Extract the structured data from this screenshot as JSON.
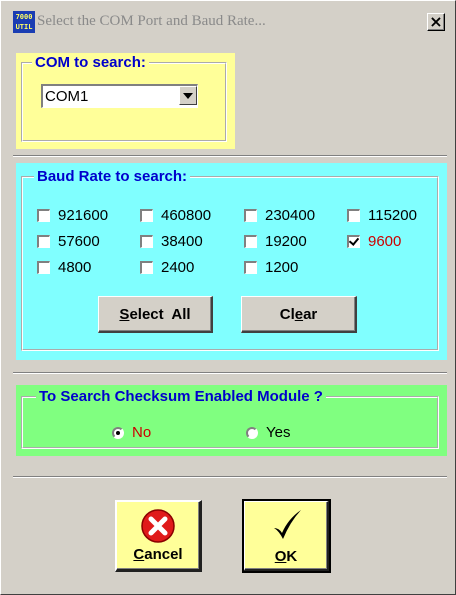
{
  "window": {
    "title": "Select the COM Port and Baud Rate...",
    "icon_text_top": "7000",
    "icon_text_bottom": "UTIL",
    "close_label": "×"
  },
  "com_group": {
    "legend": "COM to search:",
    "selected": "COM1"
  },
  "baud_group": {
    "legend": "Baud Rate to search:",
    "rates": [
      {
        "label": "921600",
        "checked": false
      },
      {
        "label": "460800",
        "checked": false
      },
      {
        "label": "230400",
        "checked": false
      },
      {
        "label": "115200",
        "checked": false
      },
      {
        "label": "57600",
        "checked": false
      },
      {
        "label": "38400",
        "checked": false
      },
      {
        "label": "19200",
        "checked": false
      },
      {
        "label": "9600",
        "checked": true
      },
      {
        "label": "4800",
        "checked": false
      },
      {
        "label": "2400",
        "checked": false
      },
      {
        "label": "1200",
        "checked": false
      }
    ],
    "select_all_mnemonic": "S",
    "select_all_rest": "elect  All",
    "clear_prefix": "Cl",
    "clear_mnemonic": "e",
    "clear_suffix": "ar"
  },
  "checksum_group": {
    "legend": "To Search Checksum Enabled Module ?",
    "options": [
      {
        "label": "No",
        "selected": true
      },
      {
        "label": "Yes",
        "selected": false
      }
    ]
  },
  "buttons": {
    "cancel_mnemonic": "C",
    "cancel_rest": "ancel",
    "ok_mnemonic": "O",
    "ok_rest": "K"
  },
  "colors": {
    "com_bg": "#ffff99",
    "baud_bg": "#80ffff",
    "checksum_bg": "#80ff80",
    "legend": "#0000cc",
    "selected_red": "#cc0000"
  }
}
